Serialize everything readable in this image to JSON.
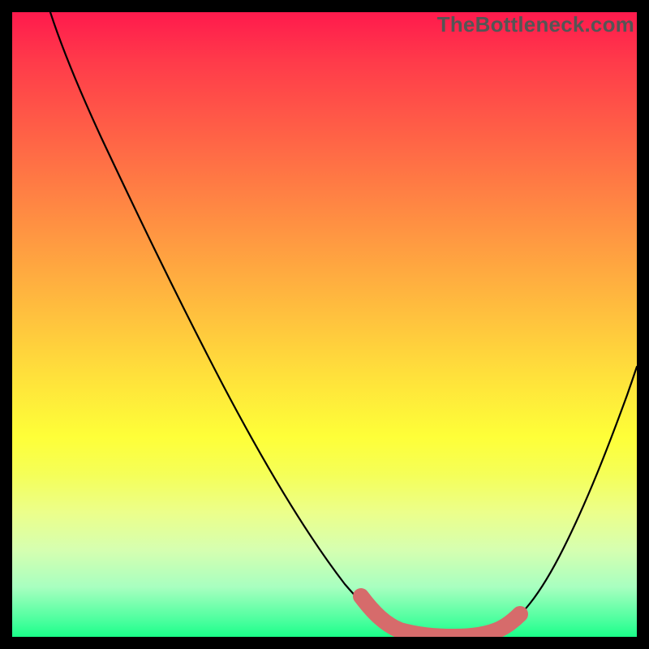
{
  "watermark": "TheBottleneck.com",
  "colors": {
    "frame": "#000000",
    "gradient_top": "#ff1a4d",
    "gradient_bottom": "#1aff88",
    "curve": "#000000",
    "marker": "#d66b6b"
  },
  "chart_data": {
    "type": "line",
    "title": "",
    "xlabel": "",
    "ylabel": "",
    "xlim": [
      0,
      100
    ],
    "ylim": [
      0,
      100
    ],
    "x": [
      0,
      5,
      10,
      15,
      20,
      25,
      30,
      35,
      40,
      45,
      50,
      55,
      60,
      63,
      66,
      70,
      75,
      80,
      85,
      90,
      95,
      100
    ],
    "y": [
      100,
      92,
      84,
      76,
      68,
      60,
      52,
      44,
      36,
      28,
      20,
      12,
      6,
      3,
      1,
      0,
      0,
      1,
      6,
      20,
      38,
      58
    ],
    "highlight_range_x": [
      60,
      80
    ],
    "notes": "V-shaped curve with broad flat minimum around x≈70–78, highlighted by thick salmon marker near bottom; no axis ticks or labels visible."
  }
}
